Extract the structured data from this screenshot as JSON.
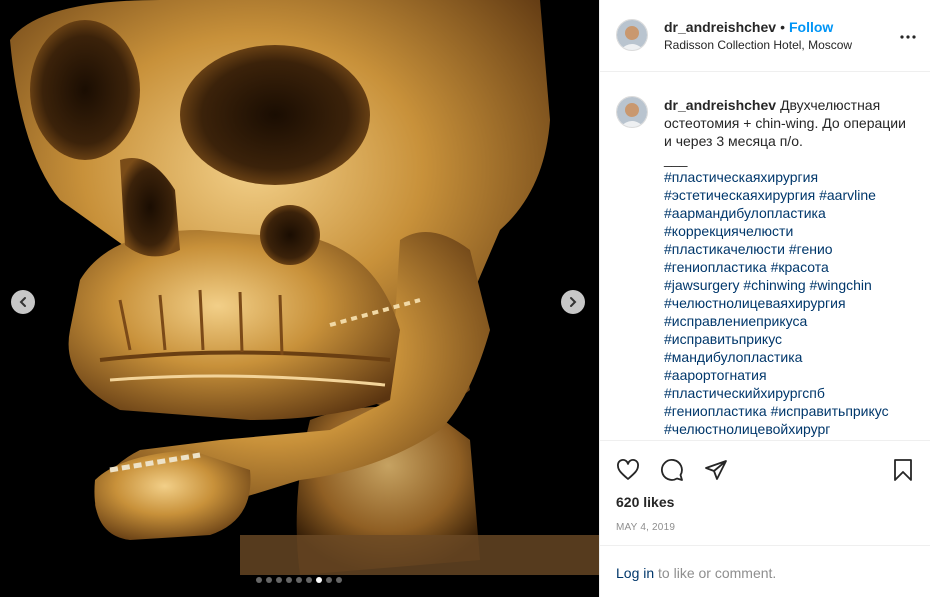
{
  "post": {
    "username": "dr_andreishchev",
    "separator": "•",
    "follow_label": "Follow",
    "location": "Radisson Collection Hotel, Moscow",
    "caption_text": "Двухчелюстная остеотомия + chin-wing. До операции и через 3 месяца п/о.",
    "caption_dash": "___",
    "hashtag_lines": [
      [
        "#пластическаяхирургия"
      ],
      [
        "#эстетическаяхирургия",
        "#aarvline"
      ],
      [
        "#аармандибулопластика"
      ],
      [
        "#коррекциячелюсти"
      ],
      [
        "#пластикачелюсти",
        "#генио"
      ],
      [
        "#гениопластика",
        "#красота"
      ],
      [
        "#jawsurgery",
        "#chinwing",
        "#wingchin"
      ],
      [
        "#челюстнолицеваяхирургия"
      ],
      [
        "#исправлениеприкуса"
      ],
      [
        "#исправитьприкус"
      ],
      [
        "#мандибулопластика"
      ],
      [
        "#аарортогнатия"
      ],
      [
        "#пластическийхирургспб"
      ],
      [
        "#гениопластика",
        "#исправитьприкус"
      ],
      [
        "#челюстнолицевойхирург"
      ]
    ],
    "likes": "620 likes",
    "date": "MAY 4, 2019",
    "login_link": "Log in",
    "login_rest": " to like or comment."
  },
  "carousel": {
    "total": 9,
    "active_index": 6
  },
  "icons": {
    "more": "more-options-icon",
    "like": "heart-icon",
    "comment": "comment-icon",
    "share": "share-icon",
    "save": "bookmark-icon",
    "prev": "chevron-left-icon",
    "next": "chevron-right-icon"
  },
  "colors": {
    "follow": "#0095f6",
    "hashtag": "#00376b",
    "muted": "#8e8e8e",
    "bone": "#c8913a"
  }
}
